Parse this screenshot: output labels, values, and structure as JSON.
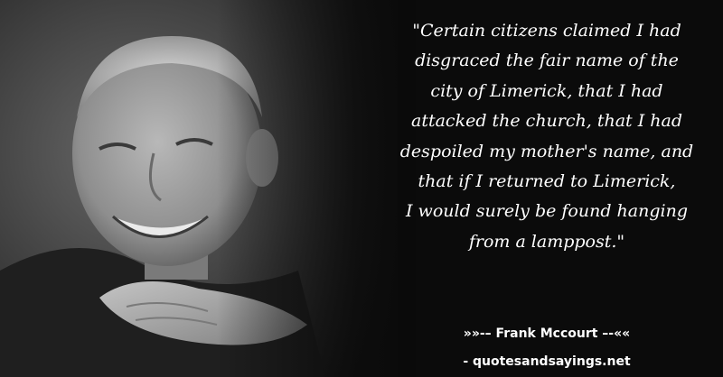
{
  "quote": {
    "lines": [
      "\"Certain citizens claimed I had",
      "disgraced the fair name of the",
      "city of Limerick, that I had",
      "attacked the church, that I had",
      "despoiled my mother's name, and",
      "that if I returned to Limerick,",
      "I would surely be found hanging",
      "from a lamppost.\""
    ]
  },
  "author": "»»-– Frank Mccourt –-««",
  "site": "- quotesandsayings.net",
  "colors": {
    "background": "#0a0a0a",
    "text": "#ffffff"
  }
}
